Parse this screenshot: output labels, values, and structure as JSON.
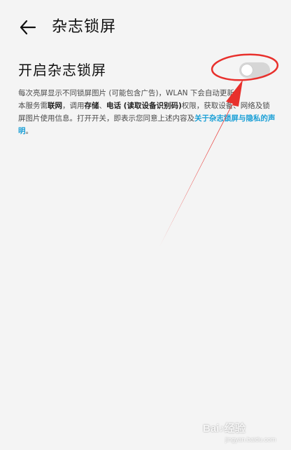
{
  "header": {
    "title": "杂志锁屏"
  },
  "setting": {
    "label": "开启杂志锁屏",
    "toggle_on": false
  },
  "description": {
    "line1": "每次亮屏显示不同锁屏图片 (可能包含广告)，WLAN 下会自动更新。",
    "p2_a": "本服务需",
    "p2_b": "联网",
    "p2_c": "，调用",
    "p2_d": "存储",
    "p2_e": "、",
    "p2_f": "电话 (读取设备识别码)",
    "p2_g": "权限，获取设备、网络及锁屏图片使用信息。打开开关，即表示您同意上述内容及",
    "p2_link": "关于杂志锁屏与隐私的声明",
    "p2_end": "。"
  },
  "watermark": {
    "brand": "Bai♪经验",
    "url": "jingyan.baidu.com"
  },
  "colors": {
    "background": "#f4f4f4",
    "link": "#1a9fd6",
    "toggle_off": "#d6d6d6",
    "annotation": "#e8302c"
  }
}
